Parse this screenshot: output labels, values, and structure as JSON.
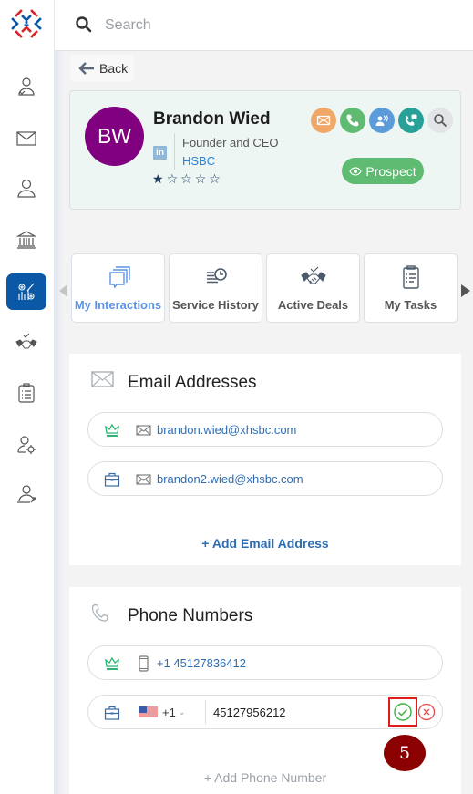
{
  "search": {
    "placeholder": "Search"
  },
  "sidebar": {
    "items": [
      {
        "icon": "contact-check-icon",
        "active": false
      },
      {
        "icon": "mail-icon",
        "active": false
      },
      {
        "icon": "person-icon",
        "active": false
      },
      {
        "icon": "bank-icon",
        "active": false
      },
      {
        "icon": "analytics-gear-icon",
        "active": true
      },
      {
        "icon": "handshake-icon",
        "active": false
      },
      {
        "icon": "clipboard-list-icon",
        "active": false
      },
      {
        "icon": "user-settings-icon",
        "active": false
      },
      {
        "icon": "user-share-icon",
        "active": false
      }
    ]
  },
  "back": {
    "label": "Back"
  },
  "profile": {
    "initials": "BW",
    "name": "Brandon Wied",
    "linkedin": "in",
    "title": "Founder and CEO",
    "company": "HSBC",
    "rating": 1,
    "rating_max": 5,
    "status": "Prospect",
    "avatar_color": "#800080",
    "actions": [
      {
        "name": "email",
        "color": "#f0a868"
      },
      {
        "name": "call",
        "color": "#5fba72"
      },
      {
        "name": "meeting",
        "color": "#5c9bd9"
      },
      {
        "name": "call-message",
        "color": "#2aa198"
      },
      {
        "name": "search",
        "color": "#e2e4e8"
      }
    ]
  },
  "tiles": [
    {
      "label": "My Interactions",
      "active": true
    },
    {
      "label": "Service History",
      "active": false
    },
    {
      "label": "Active Deals",
      "active": false
    },
    {
      "label": "My Tasks",
      "active": false
    }
  ],
  "emails": {
    "title": "Email Addresses",
    "items": [
      {
        "type": "primary",
        "value": "brandon.wied@xhsbc.com"
      },
      {
        "type": "work",
        "value": "brandon2.wied@xhsbc.com"
      }
    ],
    "add_label": "+ Add Email Address"
  },
  "phones": {
    "title": "Phone Numbers",
    "items": [
      {
        "type": "primary",
        "value": "+1 45127836412"
      }
    ],
    "editing": {
      "type": "work",
      "country_code": "+1",
      "number": "45127956212"
    },
    "add_label": "+ Add Phone Number"
  },
  "annotation": {
    "step": "5"
  },
  "colors": {
    "accent": "#0b58a6",
    "link": "#2e6db4",
    "crown": "#2bb673",
    "confirm": "#3cb043",
    "cancel": "#e05050"
  }
}
